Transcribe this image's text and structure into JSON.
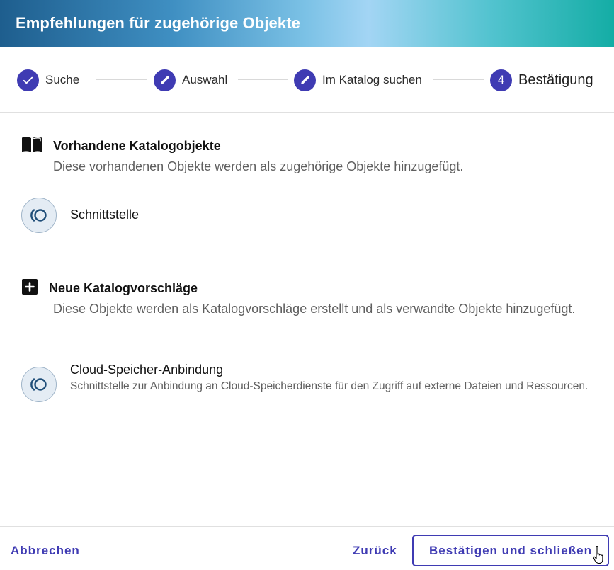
{
  "header": {
    "title": "Empfehlungen für zugehörige Objekte"
  },
  "stepper": {
    "steps": [
      {
        "label": "Suche",
        "state": "done",
        "icon": "check-icon"
      },
      {
        "label": "Auswahl",
        "state": "edited",
        "icon": "pencil-icon"
      },
      {
        "label": "Im Katalog suchen",
        "state": "edited",
        "icon": "pencil-icon"
      },
      {
        "label": "Bestätigung",
        "state": "active",
        "number": "4"
      }
    ]
  },
  "existing": {
    "icon": "book-open-icon",
    "title": "Vorhandene Katalogobjekte",
    "description": "Diese vorhandenen Objekte werden als zugehörige Objekte hinzugefügt.",
    "items": [
      {
        "name": "Schnittstelle",
        "icon": "interface-icon"
      }
    ]
  },
  "suggestions": {
    "icon": "plus-box-icon",
    "title": "Neue Katalogvorschläge",
    "description": "Diese Objekte werden als Katalogvorschläge erstellt und als verwandte Objekte hinzugefügt.",
    "items": [
      {
        "name": "Cloud-Speicher-Anbindung",
        "description": "Schnittstelle zur Anbindung an Cloud-Speicherdienste für den Zugriff auf externe Dateien und Ressourcen.",
        "icon": "interface-icon"
      }
    ]
  },
  "footer": {
    "cancel_label": "Abbrechen",
    "back_label": "Zurück",
    "confirm_label": "Bestätigen und schließen"
  },
  "colors": {
    "accent": "#3f3bb3",
    "header_gradient": [
      "#1e5e8e",
      "#a3d5f4",
      "#14ada5"
    ],
    "avatar_bg": "#e4ecf4",
    "avatar_icon": "#1f4e79"
  }
}
